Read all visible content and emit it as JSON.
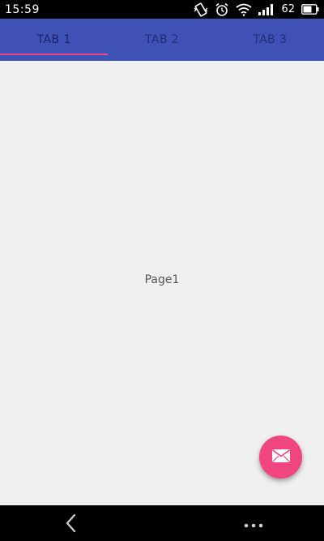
{
  "status_bar": {
    "time": "15:59",
    "battery_percent": "62",
    "icons": [
      "vibrate-icon",
      "alarm-icon",
      "wifi-icon",
      "signal-icon",
      "battery-icon"
    ]
  },
  "tabs": [
    {
      "label": "TAB 1",
      "active": true
    },
    {
      "label": "TAB 2",
      "active": false
    },
    {
      "label": "TAB 3",
      "active": false
    }
  ],
  "content": {
    "page_label": "Page1"
  },
  "fab": {
    "icon": "mail-icon",
    "color": "#f0457f"
  },
  "nav_bar": {
    "icons": [
      "back-icon",
      "more-icon"
    ]
  },
  "colors": {
    "primary": "#3f51b5",
    "accent": "#e64a8c",
    "background": "#efefef"
  }
}
